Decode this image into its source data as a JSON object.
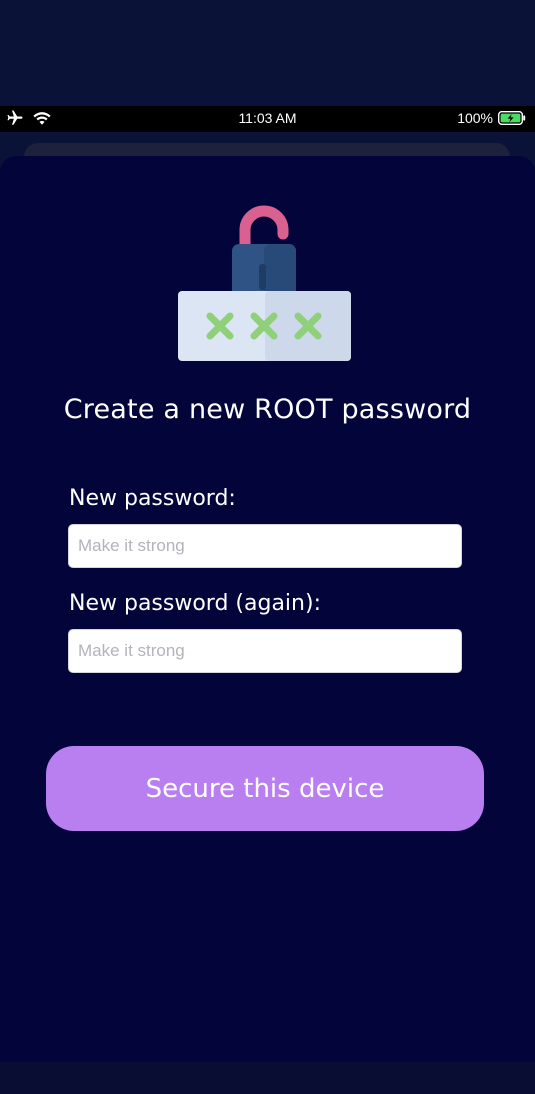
{
  "status_bar": {
    "time": "11:03 AM",
    "battery_percent": "100%",
    "icons": [
      "airplane-icon",
      "wifi-icon",
      "battery-charging-icon"
    ]
  },
  "screen": {
    "title": "Create a new ROOT password",
    "illustration": "unlocked-padlock-with-xxx-password-field"
  },
  "form": {
    "new_password_label": "New password:",
    "new_password_placeholder": "Make it strong",
    "confirm_password_label": "New password (again):",
    "confirm_password_placeholder": "Make it strong"
  },
  "actions": {
    "secure_button_label": "Secure this device"
  },
  "colors": {
    "background": "#03043a",
    "button": "#b97ff0",
    "shackle": "#d9608f",
    "lock_body": "#2e5384",
    "password_x": "#8fd07a"
  }
}
